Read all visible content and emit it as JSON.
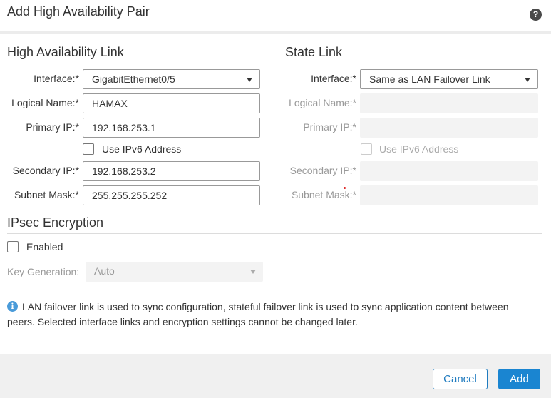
{
  "dialog": {
    "title": "Add High Availability Pair",
    "help_glyph": "?"
  },
  "ha_link": {
    "section_title": "High Availability Link",
    "interface_label": "Interface:*",
    "interface_value": "GigabitEthernet0/5",
    "logical_name_label": "Logical Name:*",
    "logical_name_value": "HAMAX",
    "primary_ip_label": "Primary IP:*",
    "primary_ip_value": "192.168.253.1",
    "ipv6_label": "Use IPv6 Address",
    "ipv6_checked": false,
    "secondary_ip_label": "Secondary IP:*",
    "secondary_ip_value": "192.168.253.2",
    "subnet_mask_label": "Subnet Mask:*",
    "subnet_mask_value": "255.255.255.252"
  },
  "state_link": {
    "section_title": "State Link",
    "interface_label": "Interface:*",
    "interface_value": "Same as LAN Failover Link",
    "logical_name_label": "Logical Name:*",
    "primary_ip_label": "Primary IP:*",
    "ipv6_label": "Use IPv6 Address",
    "secondary_ip_label": "Secondary IP:*",
    "subnet_mask_label": "Subnet Mask:*"
  },
  "ipsec": {
    "section_title": "IPsec Encryption",
    "enabled_label": "Enabled",
    "enabled_checked": false,
    "key_generation_label": "Key Generation:",
    "key_generation_value": "Auto"
  },
  "info": {
    "icon_glyph": "i",
    "message": "LAN failover link is used to sync configuration, stateful failover link is used to sync application content between peers. Selected interface links and encryption settings cannot be changed later."
  },
  "footer": {
    "cancel_label": "Cancel",
    "add_label": "Add"
  },
  "colors": {
    "primary_button": "#1a85d1",
    "info_icon": "#4a9bd9",
    "disabled_field": "#f3f3f3"
  }
}
